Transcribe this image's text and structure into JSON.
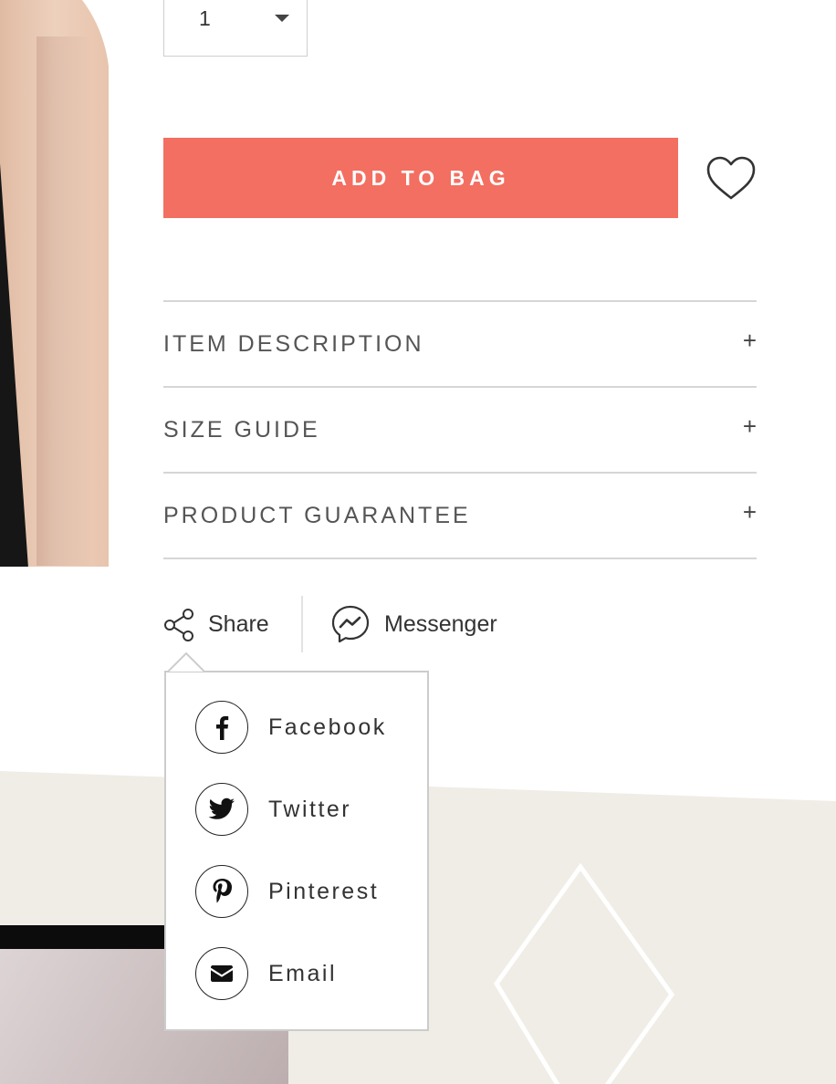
{
  "quantity": {
    "value": "1"
  },
  "add_to_bag": {
    "label": "ADD TO BAG"
  },
  "colors": {
    "accent": "#f36f61",
    "beige": "#f0ede6"
  },
  "accordion": [
    {
      "label": "ITEM DESCRIPTION",
      "icon": "+"
    },
    {
      "label": "SIZE GUIDE",
      "icon": "+"
    },
    {
      "label": "PRODUCT GUARANTEE",
      "icon": "+"
    }
  ],
  "share": {
    "label": "Share",
    "icon": "share-icon"
  },
  "messenger": {
    "label": "Messenger",
    "icon": "messenger-icon"
  },
  "share_menu": [
    {
      "label": "Facebook",
      "icon": "facebook-icon"
    },
    {
      "label": "Twitter",
      "icon": "twitter-icon"
    },
    {
      "label": "Pinterest",
      "icon": "pinterest-icon"
    },
    {
      "label": "Email",
      "icon": "email-icon"
    }
  ]
}
